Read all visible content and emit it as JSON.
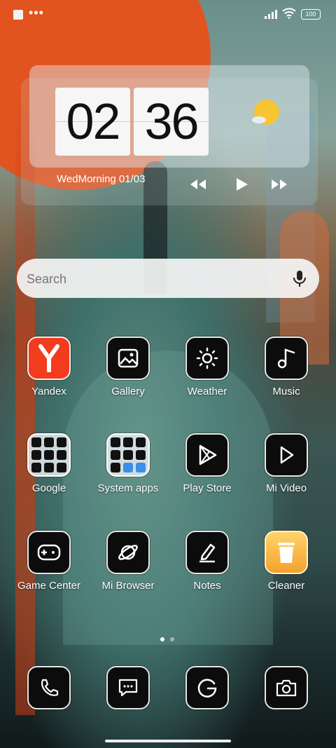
{
  "status_bar": {
    "battery_level": "100"
  },
  "clock_widget": {
    "hours": "02",
    "minutes": "36",
    "date_text": "WedMorning 01/03",
    "weather_icon": "sun-cloud-icon"
  },
  "search": {
    "placeholder": "Search"
  },
  "apps": [
    {
      "label": "Yandex",
      "icon": "yandex-icon"
    },
    {
      "label": "Gallery",
      "icon": "gallery-icon"
    },
    {
      "label": "Weather",
      "icon": "sun-icon"
    },
    {
      "label": "Music",
      "icon": "music-note-icon"
    },
    {
      "label": "Google",
      "icon": "google-folder-icon"
    },
    {
      "label": "System apps",
      "icon": "system-apps-folder-icon"
    },
    {
      "label": "Play Store",
      "icon": "play-store-icon"
    },
    {
      "label": "Mi Video",
      "icon": "play-icon"
    },
    {
      "label": "Game Center",
      "icon": "gamepad-icon"
    },
    {
      "label": "Mi Browser",
      "icon": "planet-icon"
    },
    {
      "label": "Notes",
      "icon": "pencil-icon"
    },
    {
      "label": "Cleaner",
      "icon": "trash-icon"
    }
  ],
  "dock": [
    {
      "icon": "phone-icon"
    },
    {
      "icon": "messages-icon"
    },
    {
      "icon": "google-icon"
    },
    {
      "icon": "camera-icon"
    }
  ],
  "page_indicator": {
    "pages": 2,
    "current": 1
  },
  "colors": {
    "yandex": "#f33b1d",
    "cleaner": "#f3a22b",
    "sun": "#f7c531"
  }
}
